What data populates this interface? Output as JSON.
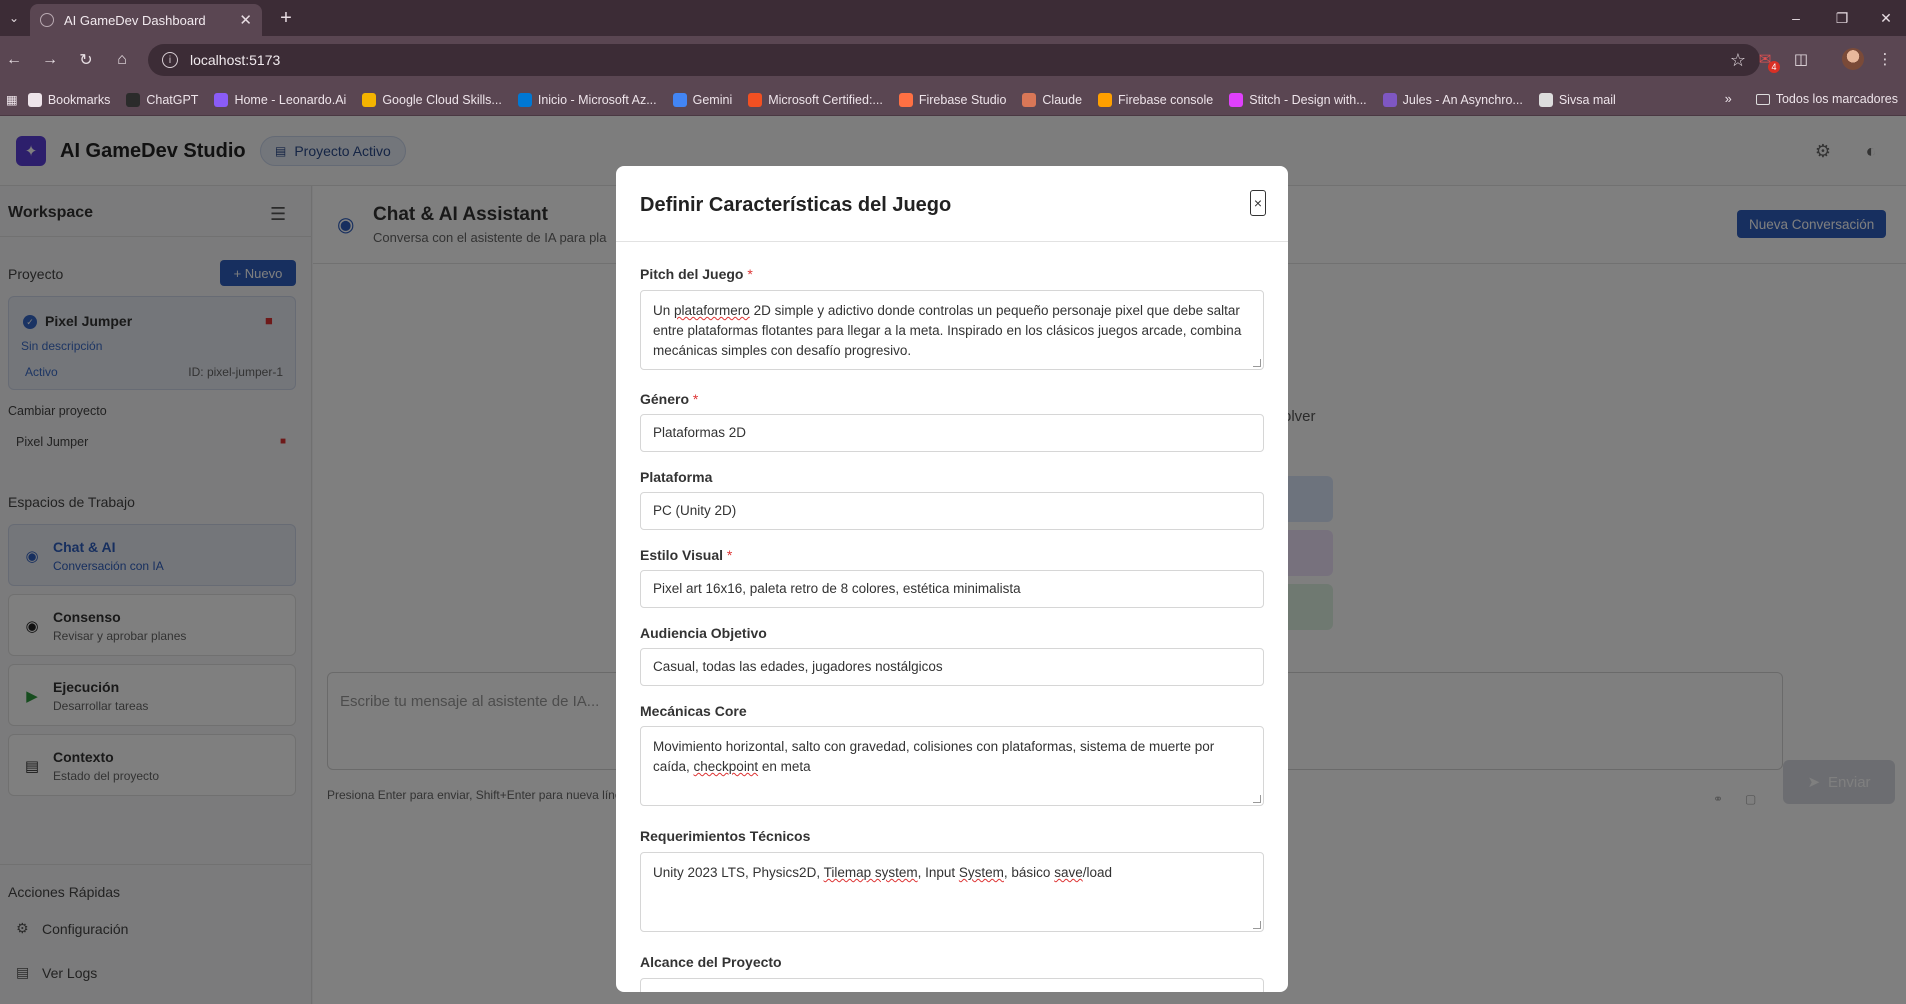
{
  "browser": {
    "tab_title": "AI GameDev Dashboard",
    "url": "localhost:5173",
    "extension_badge": "4",
    "bookmarks": [
      {
        "label": "Bookmarks",
        "color": "#eee4ea"
      },
      {
        "label": "ChatGPT",
        "color": "#2b2b2b"
      },
      {
        "label": "Home - Leonardo.Ai",
        "color": "#8a5cf6"
      },
      {
        "label": "Google Cloud Skills...",
        "color": "#f4b400"
      },
      {
        "label": "Inicio - Microsoft Az...",
        "color": "#0078d4"
      },
      {
        "label": "Gemini",
        "color": "#4285f4"
      },
      {
        "label": "Microsoft Certified:...",
        "color": "#f25022"
      },
      {
        "label": "Firebase Studio",
        "color": "#ff7043"
      },
      {
        "label": "Claude",
        "color": "#d97757"
      },
      {
        "label": "Firebase console",
        "color": "#ffa000"
      },
      {
        "label": "Stitch - Design with...",
        "color": "#e040fb"
      },
      {
        "label": "Jules - An Asynchro...",
        "color": "#7e57c2"
      },
      {
        "label": "Sivsa mail",
        "color": "#dddddd"
      }
    ],
    "all_bookmarks": "Todos los marcadores"
  },
  "header": {
    "app_title": "AI GameDev Studio",
    "project_pill": "Proyecto Activo"
  },
  "sidebar": {
    "title": "Workspace",
    "project_section": "Proyecto",
    "new_button": "+ Nuevo",
    "project": {
      "name": "Pixel Jumper",
      "description": "Sin descripción",
      "status": "Activo",
      "id": "ID: pixel-jumper-1"
    },
    "change_project_label": "Cambiar proyecto",
    "switch_item": "Pixel Jumper",
    "workspaces_label": "Espacios de Trabajo",
    "workspaces": [
      {
        "title": "Chat & AI",
        "subtitle": "Conversación con IA",
        "icon": "chat-icon"
      },
      {
        "title": "Consenso",
        "subtitle": "Revisar y aprobar planes",
        "icon": "consensus-icon"
      },
      {
        "title": "Ejecución",
        "subtitle": "Desarrollar tareas",
        "icon": "play-icon"
      },
      {
        "title": "Contexto",
        "subtitle": "Estado del proyecto",
        "icon": "document-icon"
      }
    ],
    "quick_actions_label": "Acciones Rápidas",
    "quick_actions": [
      "Configuración",
      "Ver Logs"
    ]
  },
  "main": {
    "title": "Chat & AI Assistant",
    "subtitle": "Conversa con el asistente de IA para pla",
    "new_conversation": "Nueva Conversación",
    "hint_fragment": "olver",
    "input_placeholder": "Escribe tu mensaje al asistente de IA...",
    "input_hint": "Presiona Enter para enviar, Shift+Enter para nueva líne",
    "send_button": "Enviar"
  },
  "modal": {
    "title": "Definir Características del Juego",
    "fields": {
      "pitch": {
        "label": "Pitch del Juego",
        "required": "*",
        "value_pre": "Un ",
        "value_squig": "plataformero",
        "value_post": " 2D simple y adictivo donde controlas un pequeño personaje pixel que debe saltar entre plataformas flotantes para llegar a la meta. Inspirado en los clásicos juegos arcade, combina mecánicas simples con desafío progresivo."
      },
      "genre": {
        "label": "Género",
        "required": "*",
        "value": "Plataformas 2D"
      },
      "platform": {
        "label": "Plataforma",
        "value": "PC (Unity 2D)"
      },
      "visual_style": {
        "label": "Estilo Visual",
        "required": "*",
        "value": "Pixel art 16x16, paleta retro de 8 colores, estética minimalista"
      },
      "audience": {
        "label": "Audiencia Objetivo",
        "value": "Casual, todas las edades, jugadores nostálgicos"
      },
      "mechanics": {
        "label": "Mecánicas Core",
        "value_pre": "Movimiento horizontal, salto con gravedad, colisiones con plataformas, sistema de muerte por caída, ",
        "value_squig": "checkpoint",
        "value_post": " en meta"
      },
      "tech": {
        "label": "Requerimientos Técnicos",
        "parts": [
          "Unity 2023 LTS, Physics2D, ",
          "Tilemap system",
          ", Input ",
          "System",
          ", básico ",
          "save",
          "/load"
        ]
      },
      "scope": {
        "label": "Alcance del Proyecto"
      }
    }
  },
  "colors": {
    "accent": "#2f5fbf",
    "logo": "#5b3fd8",
    "danger": "#dd3333",
    "chrome": "#5a4652"
  }
}
